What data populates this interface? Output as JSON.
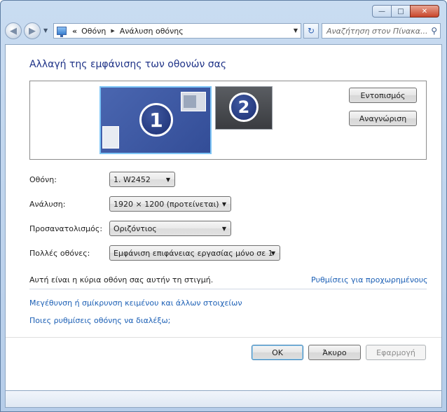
{
  "window": {
    "caption": {
      "minimize": "—",
      "maximize": "□",
      "close": "✕"
    }
  },
  "nav": {
    "breadcrumb_prefix": "«",
    "crumbs": [
      "Οθόνη",
      "Ανάλυση οθόνης"
    ],
    "search_placeholder": "Αναζήτηση στον Πίνακα...",
    "refresh_glyph": "↻",
    "search_glyph": "⚲"
  },
  "page": {
    "title": "Αλλαγή της εμφάνισης των οθονών σας"
  },
  "preview": {
    "monitors": [
      {
        "number": "1",
        "selected": true
      },
      {
        "number": "2",
        "selected": false
      }
    ],
    "detect_button": "Εντοπισμός",
    "identify_button": "Αναγνώριση"
  },
  "form": {
    "display_label": "Οθόνη:",
    "display_value": "1. W2452",
    "resolution_label": "Ανάλυση:",
    "resolution_value": "1920 × 1200 (προτείνεται)",
    "orientation_label": "Προσανατολισμός:",
    "orientation_value": "Οριζόντιος",
    "multiple_label": "Πολλές οθόνες:",
    "multiple_value": "Εμφάνιση επιφάνειας εργασίας μόνο σε 1"
  },
  "info": {
    "main_display_text": "Αυτή είναι η κύρια οθόνη σας αυτήν τη στιγμή.",
    "advanced_link": "Ρυθμίσεις για προχωρημένους"
  },
  "links": {
    "text_size": "Μεγέθυνση ή σμίκρυνση κειμένου και άλλων στοιχείων",
    "which_settings": "Ποιες ρυθμίσεις οθόνης να διαλέξω;"
  },
  "footer": {
    "ok": "OK",
    "cancel": "Άκυρο",
    "apply": "Εφαρμογή"
  },
  "colors": {
    "title": "#1e3287",
    "link": "#1b5fb5",
    "selected_monitor_border": "#7cc4f6"
  }
}
